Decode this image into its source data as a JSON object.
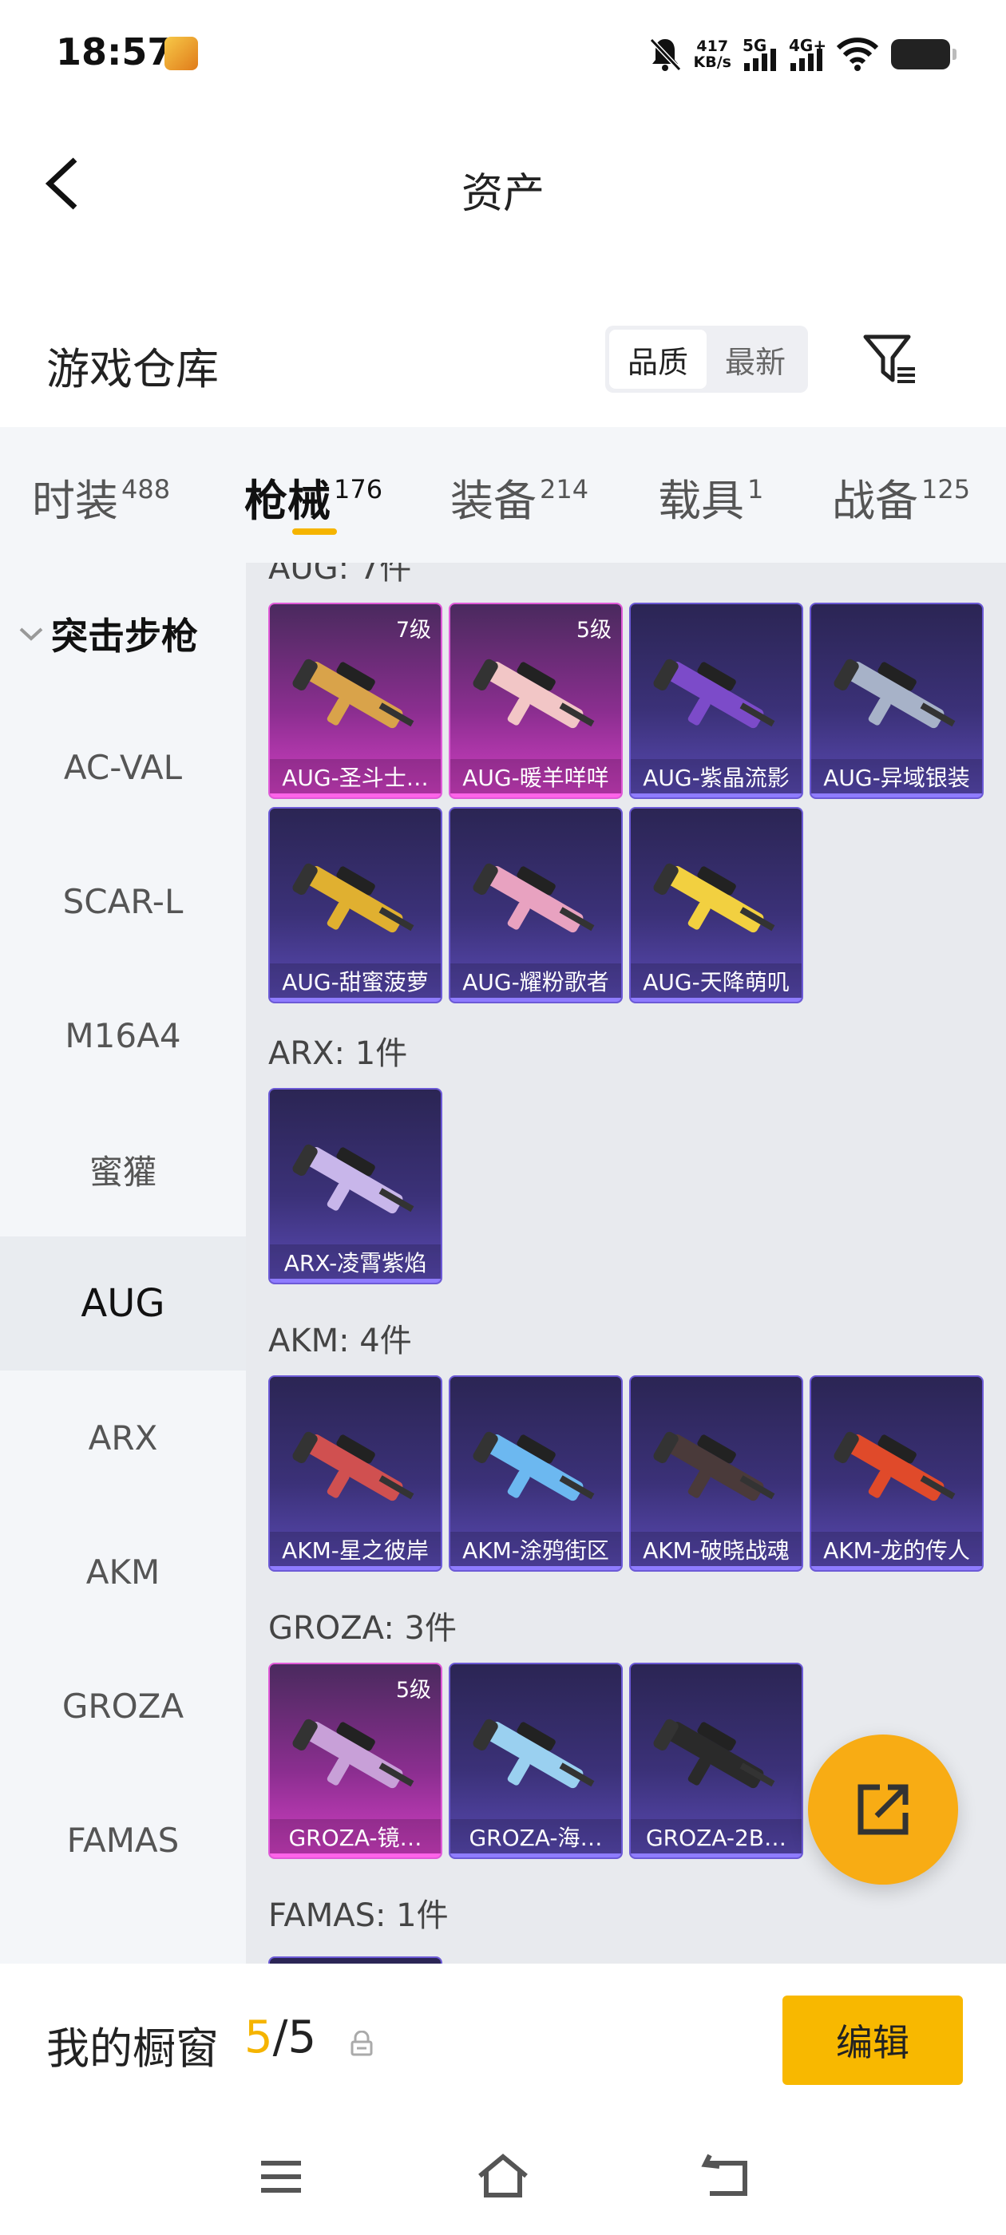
{
  "status_bar": {
    "time": "18:57",
    "speed_value": "417",
    "speed_unit": "KB/s",
    "net1": "5G",
    "net2": "4G+"
  },
  "header": {
    "title": "资产"
  },
  "warehouse": {
    "title": "游戏仓库",
    "sort": [
      "品质",
      "最新"
    ]
  },
  "tabs": [
    {
      "label": "时装",
      "count": "488"
    },
    {
      "label": "枪械",
      "count": "176"
    },
    {
      "label": "装备",
      "count": "214"
    },
    {
      "label": "载具",
      "count": "1"
    },
    {
      "label": "战备",
      "count": "125"
    }
  ],
  "sidebar": {
    "group": "突击步枪",
    "items": [
      "AC-VAL",
      "SCAR-L",
      "M16A4",
      "蜜獾",
      "AUG",
      "ARX",
      "AKM",
      "GROZA",
      "FAMAS"
    ]
  },
  "sections": [
    {
      "title": "AUG: 7件",
      "items": [
        {
          "name": "AUG-圣斗士…",
          "level": "7级",
          "rarity": "pink"
        },
        {
          "name": "AUG-暖羊咩咩",
          "level": "5级",
          "rarity": "pink"
        },
        {
          "name": "AUG-紫晶流影",
          "level": "",
          "rarity": "purple"
        },
        {
          "name": "AUG-异域银装",
          "level": "",
          "rarity": "purple"
        },
        {
          "name": "AUG-甜蜜菠萝",
          "level": "",
          "rarity": "purple"
        },
        {
          "name": "AUG-耀粉歌者",
          "level": "",
          "rarity": "purple"
        },
        {
          "name": "AUG-天降萌叽",
          "level": "",
          "rarity": "purple"
        }
      ]
    },
    {
      "title": "ARX: 1件",
      "items": [
        {
          "name": "ARX-凌霄紫焰",
          "level": "",
          "rarity": "purple"
        }
      ]
    },
    {
      "title": "AKM: 4件",
      "items": [
        {
          "name": "AKM-星之彼岸",
          "level": "",
          "rarity": "purple"
        },
        {
          "name": "AKM-涂鸦街区",
          "level": "",
          "rarity": "purple"
        },
        {
          "name": "AKM-破晓战魂",
          "level": "",
          "rarity": "purple"
        },
        {
          "name": "AKM-龙的传人",
          "level": "",
          "rarity": "purple"
        }
      ]
    },
    {
      "title": "GROZA: 3件",
      "items": [
        {
          "name": "GROZA-镜…",
          "level": "5级",
          "rarity": "pink"
        },
        {
          "name": "GROZA-海…",
          "level": "",
          "rarity": "purple"
        },
        {
          "name": "GROZA-2B…",
          "level": "",
          "rarity": "purple"
        }
      ]
    },
    {
      "title": "FAMAS: 1件",
      "items": []
    }
  ],
  "showcase": {
    "label": "我的橱窗",
    "current": "5",
    "separator": "/",
    "total": "5",
    "edit": "编辑"
  },
  "colors": {
    "accent": "#f8b800",
    "pink_card": "#d23fc4",
    "purple_card": "#5a4ab4"
  },
  "icons": [
    "back-arrow-icon",
    "filter-icon",
    "share-export-icon",
    "lock-icon",
    "menu-icon",
    "home-icon",
    "return-icon"
  ]
}
